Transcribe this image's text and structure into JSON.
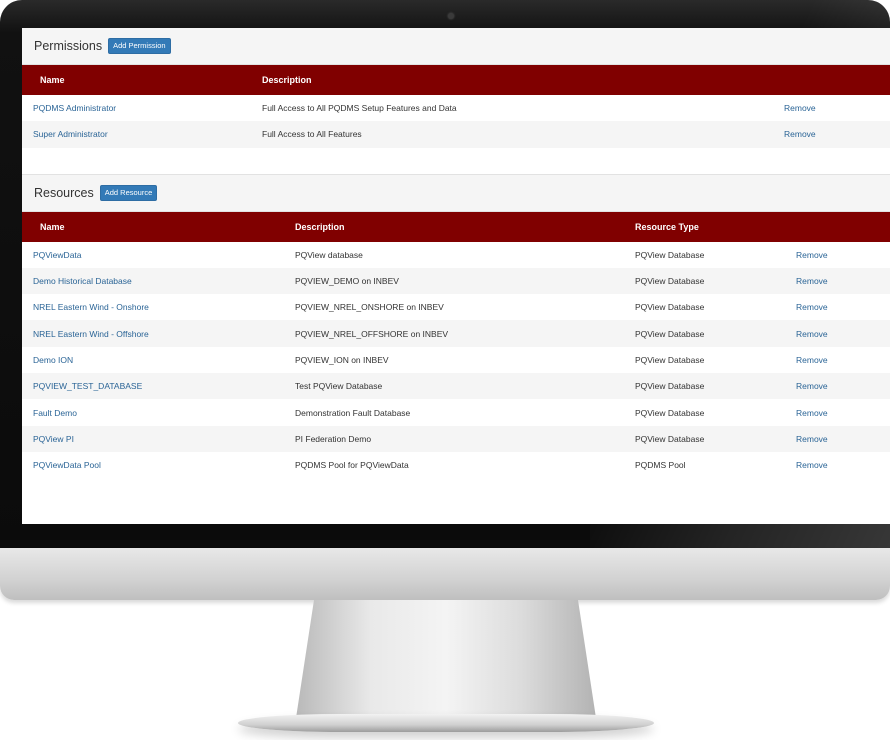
{
  "permissions": {
    "title": "Permissions",
    "add_label": "Add Permission",
    "columns": [
      "Name",
      "Description"
    ],
    "rows": [
      {
        "name": "PQDMS Administrator",
        "description": "Full Access to All PQDMS Setup Features and Data",
        "action": "Remove"
      },
      {
        "name": "Super Administrator",
        "description": "Full Access to All Features",
        "action": "Remove"
      }
    ]
  },
  "resources": {
    "title": "Resources",
    "add_label": "Add Resource",
    "columns": [
      "Name",
      "Description",
      "Resource Type"
    ],
    "rows": [
      {
        "name": "PQViewData",
        "description": "PQView database",
        "type": "PQView Database",
        "action": "Remove"
      },
      {
        "name": "Demo Historical Database",
        "description": "PQVIEW_DEMO on INBEV",
        "type": "PQView Database",
        "action": "Remove"
      },
      {
        "name": "NREL Eastern Wind - Onshore",
        "description": "PQVIEW_NREL_ONSHORE on INBEV",
        "type": "PQView Database",
        "action": "Remove"
      },
      {
        "name": "NREL Eastern Wind - Offshore",
        "description": "PQVIEW_NREL_OFFSHORE on INBEV",
        "type": "PQView Database",
        "action": "Remove"
      },
      {
        "name": "Demo ION",
        "description": "PQVIEW_ION on INBEV",
        "type": "PQView Database",
        "action": "Remove"
      },
      {
        "name": "PQVIEW_TEST_DATABASE",
        "description": "Test PQView Database",
        "type": "PQView Database",
        "action": "Remove"
      },
      {
        "name": "Fault Demo",
        "description": "Demonstration Fault Database",
        "type": "PQView Database",
        "action": "Remove"
      },
      {
        "name": "PQView PI",
        "description": "PI Federation Demo",
        "type": "PQView Database",
        "action": "Remove"
      },
      {
        "name": "PQViewData Pool",
        "description": "PQDMS Pool for PQViewData",
        "type": "PQDMS Pool",
        "action": "Remove"
      }
    ]
  },
  "colors": {
    "header_bg": "#800000",
    "link": "#2a6496",
    "button": "#337ab7"
  }
}
